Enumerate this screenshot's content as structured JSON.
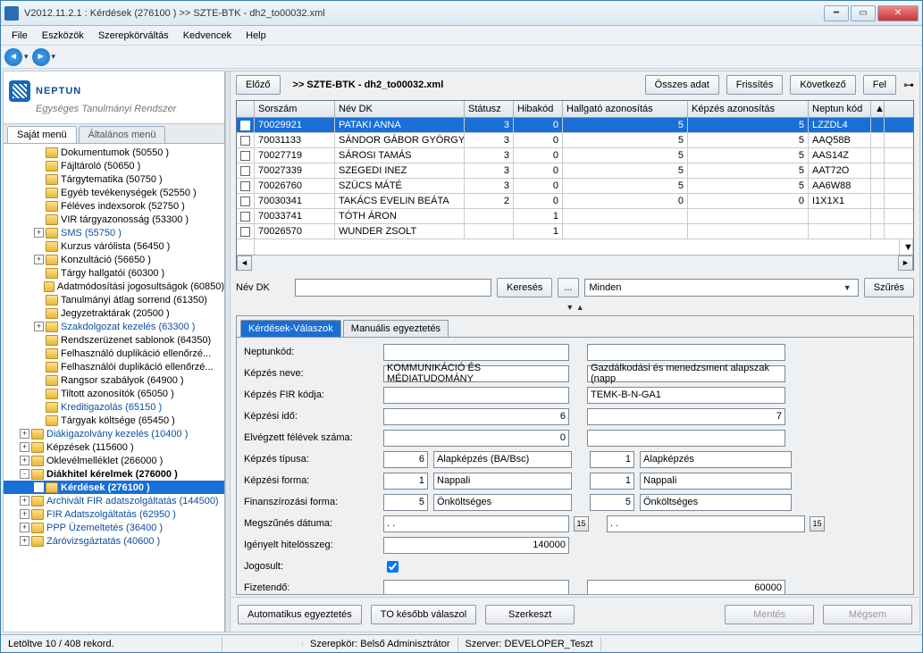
{
  "title": "V2012.11.2.1 : Kérdések (276100  )  >> SZTE-BTK - dh2_to00032.xml",
  "menu": [
    "File",
    "Eszközök",
    "Szerepkörváltás",
    "Kedvencek",
    "Help"
  ],
  "logo": {
    "main": "NEPTUN",
    "sub": "Egységes Tanulmányi Rendszer"
  },
  "left_tabs": {
    "active": "Saját menü",
    "inactive": "Általános menü"
  },
  "tree": [
    {
      "ind": 2,
      "exp": "",
      "label": "Dokumentumok (50550  )"
    },
    {
      "ind": 2,
      "exp": "",
      "label": "Fájltároló (50650  )"
    },
    {
      "ind": 2,
      "exp": "",
      "label": "Tárgytematika (50750  )"
    },
    {
      "ind": 2,
      "exp": "",
      "label": "Egyéb tevékenységek (52550  )"
    },
    {
      "ind": 2,
      "exp": "",
      "label": "Féléves indexsorok (52750  )"
    },
    {
      "ind": 2,
      "exp": "",
      "label": "VIR tárgyazonosság (53300  )"
    },
    {
      "ind": 2,
      "exp": "+",
      "label": "SMS (55750  )",
      "blue": true
    },
    {
      "ind": 2,
      "exp": "",
      "label": "Kurzus várólista (56450  )"
    },
    {
      "ind": 2,
      "exp": "+",
      "label": "Konzultáció (56650  )"
    },
    {
      "ind": 2,
      "exp": "",
      "label": "Tárgy hallgatói (60300  )"
    },
    {
      "ind": 2,
      "exp": "",
      "label": "Adatmódosítási jogosultságok (60850)"
    },
    {
      "ind": 2,
      "exp": "",
      "label": "Tanulmányi átlag sorrend (61350)"
    },
    {
      "ind": 2,
      "exp": "",
      "label": "Jegyzetraktárak (20500  )"
    },
    {
      "ind": 2,
      "exp": "+",
      "label": "Szakdolgozat kezelés (63300  )",
      "blue": true
    },
    {
      "ind": 2,
      "exp": "",
      "label": "Rendszerüzenet sablonok (64350)"
    },
    {
      "ind": 2,
      "exp": "",
      "label": "Felhasználó duplikáció ellenőrzé..."
    },
    {
      "ind": 2,
      "exp": "",
      "label": "Felhasználói duplikáció ellenőrzé..."
    },
    {
      "ind": 2,
      "exp": "",
      "label": "Rangsor szabályok (64900  )"
    },
    {
      "ind": 2,
      "exp": "",
      "label": "Tiltott azonosítók (65050  )"
    },
    {
      "ind": 2,
      "exp": "",
      "label": "Kreditigazolás (65150  )",
      "blue": true
    },
    {
      "ind": 2,
      "exp": "",
      "label": "Tárgyak költsége (65450  )"
    },
    {
      "ind": 1,
      "exp": "+",
      "label": "Diákigazolvány kezelés (10400  )",
      "blue": true
    },
    {
      "ind": 1,
      "exp": "+",
      "label": "Képzések (115600  )"
    },
    {
      "ind": 1,
      "exp": "+",
      "label": "Oklevélmelléklet (266000  )"
    },
    {
      "ind": 1,
      "exp": "-",
      "label": "Diákhitel kérelmek (276000  )",
      "bold": true
    },
    {
      "ind": 2,
      "exp": "",
      "label": "Kérdések (276100  )",
      "selected": true
    },
    {
      "ind": 1,
      "exp": "+",
      "label": "Archivált FIR adatszolgáltatás (144500)",
      "blue": true
    },
    {
      "ind": 1,
      "exp": "+",
      "label": "FIR Adatszolgáltatás (62950  )",
      "blue": true
    },
    {
      "ind": 1,
      "exp": "+",
      "label": "PPP Üzemeltetés (36400  )",
      "blue": true
    },
    {
      "ind": 1,
      "exp": "+",
      "label": "Záróvizsgáztatás (40600  )",
      "blue": true
    }
  ],
  "topbar": {
    "prev": "Előző",
    "breadcrumb": ">>  SZTE-BTK - dh2_to00032.xml",
    "all": "Összes adat",
    "refresh": "Frissítés",
    "next": "Következő",
    "up": "Fel"
  },
  "grid": {
    "headers": [
      "",
      "Sorszám",
      "Név DK",
      "Státusz",
      "Hibakód",
      "Hallgató azonosítás",
      "Képzés azonosítás",
      "Neptun kód"
    ],
    "rows": [
      {
        "sel": true,
        "s": "70029921",
        "n": "PATAKI ANNA",
        "st": "3",
        "h": "0",
        "ha": "5",
        "ka": "5",
        "nk": "LZZDL4"
      },
      {
        "s": "70031133",
        "n": "SÁNDOR GÁBOR GYÖRGY",
        "st": "3",
        "h": "0",
        "ha": "5",
        "ka": "5",
        "nk": "AAQ58B"
      },
      {
        "s": "70027719",
        "n": "SÁROSI TAMÁS",
        "st": "3",
        "h": "0",
        "ha": "5",
        "ka": "5",
        "nk": "AAS14Z"
      },
      {
        "s": "70027339",
        "n": "SZEGEDI INEZ",
        "st": "3",
        "h": "0",
        "ha": "5",
        "ka": "5",
        "nk": "AAT72O"
      },
      {
        "s": "70026760",
        "n": "SZÜCS MÁTÉ",
        "st": "3",
        "h": "0",
        "ha": "5",
        "ka": "5",
        "nk": "AA6W88"
      },
      {
        "s": "70030341",
        "n": "TAKÁCS EVELIN BEÁTA",
        "st": "2",
        "h": "0",
        "ha": "0",
        "ka": "0",
        "nk": "I1X1X1"
      },
      {
        "s": "70033741",
        "n": "TÓTH ÁRON",
        "st": "",
        "h": "1",
        "ha": "",
        "ka": "",
        "nk": ""
      },
      {
        "s": "70026570",
        "n": "WUNDER ZSOLT",
        "st": "",
        "h": "1",
        "ha": "",
        "ka": "",
        "nk": ""
      }
    ]
  },
  "search": {
    "label": "Név DK",
    "btn": "Keresés",
    "dots": "...",
    "combo": "Minden",
    "filter": "Szűrés"
  },
  "detail": {
    "tabs": {
      "active": "Kérdések-Válaszok",
      "other": "Manuális egyeztetés"
    },
    "rows": [
      {
        "label": "Neptunkód:",
        "a": "",
        "b": ""
      },
      {
        "label": "Képzés neve:",
        "a_wide": "KOMMUNIKÁCIÓ ÉS MÉDIATUDOMÁNY",
        "b_wide": "Gazdálkodási és menedzsment alapszak (napp"
      },
      {
        "label": "Képzés FIR kódja:",
        "a_wide": "",
        "b_wide": "TEMK-B-N-GA1"
      },
      {
        "label": "Képzési idő:",
        "a_wide_num": "6",
        "b_wide_num": "7"
      },
      {
        "label": "Elvégzett félévek száma:",
        "a_wide_num": "0",
        "b_wide": ""
      },
      {
        "label": "Képzés típusa:",
        "a_num": "6",
        "a_txt": "Alapképzés (BA/Bsc)",
        "b_num": "1",
        "b_txt": "Alapképzés"
      },
      {
        "label": "Képzési forma:",
        "a_num": "1",
        "a_txt": "Nappali",
        "b_num": "1",
        "b_txt": "Nappali"
      },
      {
        "label": "Finanszírozási forma:",
        "a_num": "5",
        "a_txt": "Önköltséges",
        "b_num": "5",
        "b_txt": "Önköltséges"
      },
      {
        "label": "Megszűnés dátuma:",
        "a_date": " .   .",
        "b_date": " .   ."
      },
      {
        "label": "Igényelt hitelösszeg:",
        "a_wide_num": "140000"
      },
      {
        "label": "Jogosult:",
        "check": true
      },
      {
        "label": "Fizetendő:",
        "b_wide_num": "60000"
      }
    ]
  },
  "actions": {
    "auto": "Automatikus egyeztetés",
    "later": "TO később válaszol",
    "edit": "Szerkeszt",
    "save": "Mentés",
    "cancel": "Mégsem"
  },
  "status": {
    "left": "Letöltve 10 / 408 rekord.",
    "role": "Szerepkör: Belső Adminisztrátor",
    "server": "Szerver: DEVELOPER_Teszt"
  }
}
